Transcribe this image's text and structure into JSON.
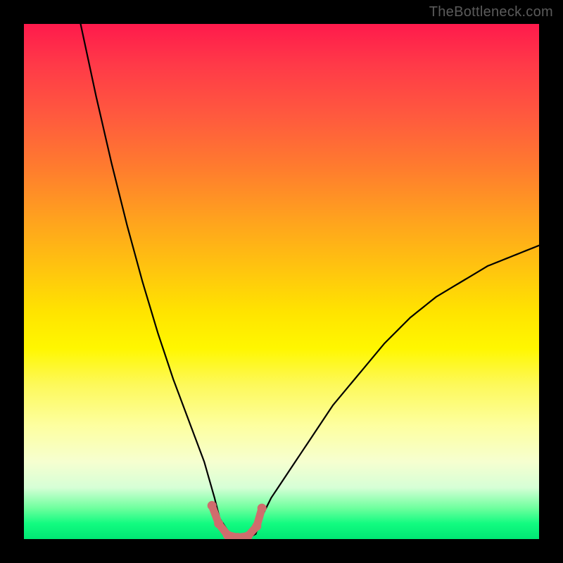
{
  "watermark": {
    "text": "TheBottleneck.com"
  },
  "colors": {
    "background": "#000000",
    "curve": "#000000",
    "marker": "#cf6d6d",
    "gradient_top": "#ff1a4c",
    "gradient_bottom": "#00e874"
  },
  "chart_data": {
    "type": "line",
    "title": "",
    "xlabel": "",
    "ylabel": "",
    "xlim": [
      0,
      100
    ],
    "ylim": [
      0,
      100
    ],
    "grid": false,
    "legend": false,
    "notes": "V-shaped bottleneck curve over a vertical red-to-green gradient background. Y values are estimated from pixel positions (0 = bottom/green, 100 = top/red). The curve reaches its minimum near x≈38–45 with a small flat plateau hugging y≈0, flanked by steep walls; the left branch rises to y≈100 at x≈11 and the right branch rises to y≈57 at x=100.",
    "series": [
      {
        "name": "bottleneck-curve",
        "x": [
          11,
          14,
          17,
          20,
          23,
          26,
          29,
          32,
          35,
          37,
          38,
          40,
          43,
          45,
          46,
          48,
          52,
          56,
          60,
          65,
          70,
          75,
          80,
          85,
          90,
          95,
          100
        ],
        "values": [
          100,
          86,
          73,
          61,
          50,
          40,
          31,
          23,
          15,
          8,
          4,
          1,
          0,
          1,
          4,
          8,
          14,
          20,
          26,
          32,
          38,
          43,
          47,
          50,
          53,
          55,
          57
        ]
      }
    ],
    "markers": {
      "name": "flat-minimum-markers",
      "x": [
        36.5,
        37.8,
        39.5,
        41.5,
        43.5,
        45.2,
        46.2
      ],
      "values": [
        6.5,
        3.0,
        0.8,
        0.3,
        0.6,
        2.5,
        6.0
      ]
    }
  }
}
